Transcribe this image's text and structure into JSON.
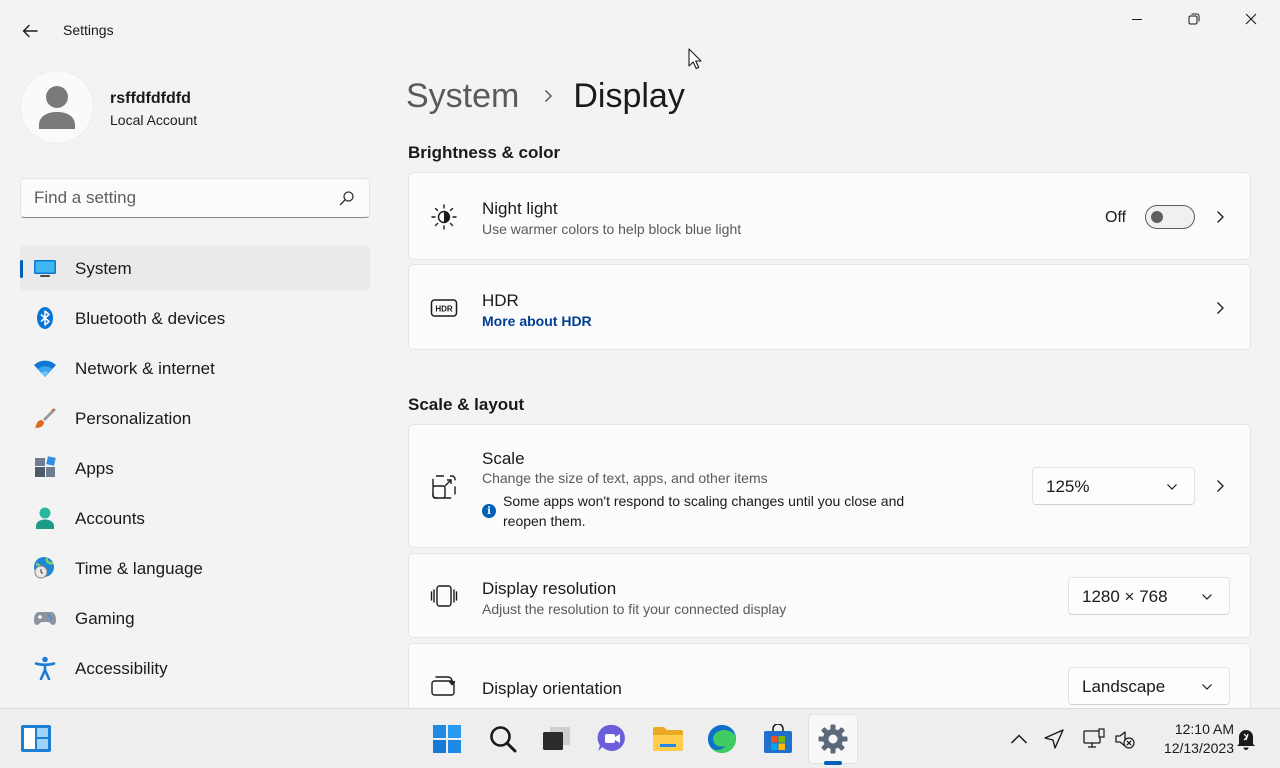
{
  "window": {
    "title": "Settings"
  },
  "profile": {
    "name": "rsffdfdfdfd",
    "account_type": "Local Account"
  },
  "search": {
    "placeholder": "Find a setting"
  },
  "sidebar": {
    "items": [
      {
        "label": "System",
        "icon": "monitor-icon",
        "active": true
      },
      {
        "label": "Bluetooth & devices",
        "icon": "bluetooth-icon"
      },
      {
        "label": "Network & internet",
        "icon": "wifi-icon"
      },
      {
        "label": "Personalization",
        "icon": "paintbrush-icon"
      },
      {
        "label": "Apps",
        "icon": "apps-icon"
      },
      {
        "label": "Accounts",
        "icon": "person-icon"
      },
      {
        "label": "Time & language",
        "icon": "globe-clock-icon"
      },
      {
        "label": "Gaming",
        "icon": "gamepad-icon"
      },
      {
        "label": "Accessibility",
        "icon": "accessibility-icon"
      }
    ]
  },
  "breadcrumb": {
    "parent": "System",
    "current": "Display"
  },
  "sections": {
    "brightness": {
      "title": "Brightness & color",
      "night_light": {
        "title": "Night light",
        "subtitle": "Use warmer colors to help block blue light",
        "state": "Off"
      },
      "hdr": {
        "title": "HDR",
        "link": "More about HDR"
      }
    },
    "scale_layout": {
      "title": "Scale & layout",
      "scale": {
        "title": "Scale",
        "subtitle": "Change the size of text, apps, and other items",
        "info_line1": "Some apps won't respond to scaling changes until you close and",
        "info_line2": "reopen them.",
        "value": "125%"
      },
      "resolution": {
        "title": "Display resolution",
        "subtitle": "Adjust the resolution to fit your connected display",
        "value": "1280 × 768"
      },
      "orientation": {
        "title": "Display orientation",
        "value": "Landscape"
      }
    }
  },
  "taskbar": {
    "clock_time": "12:10 AM",
    "clock_date": "12/13/2023",
    "accent": "#005fb8"
  }
}
